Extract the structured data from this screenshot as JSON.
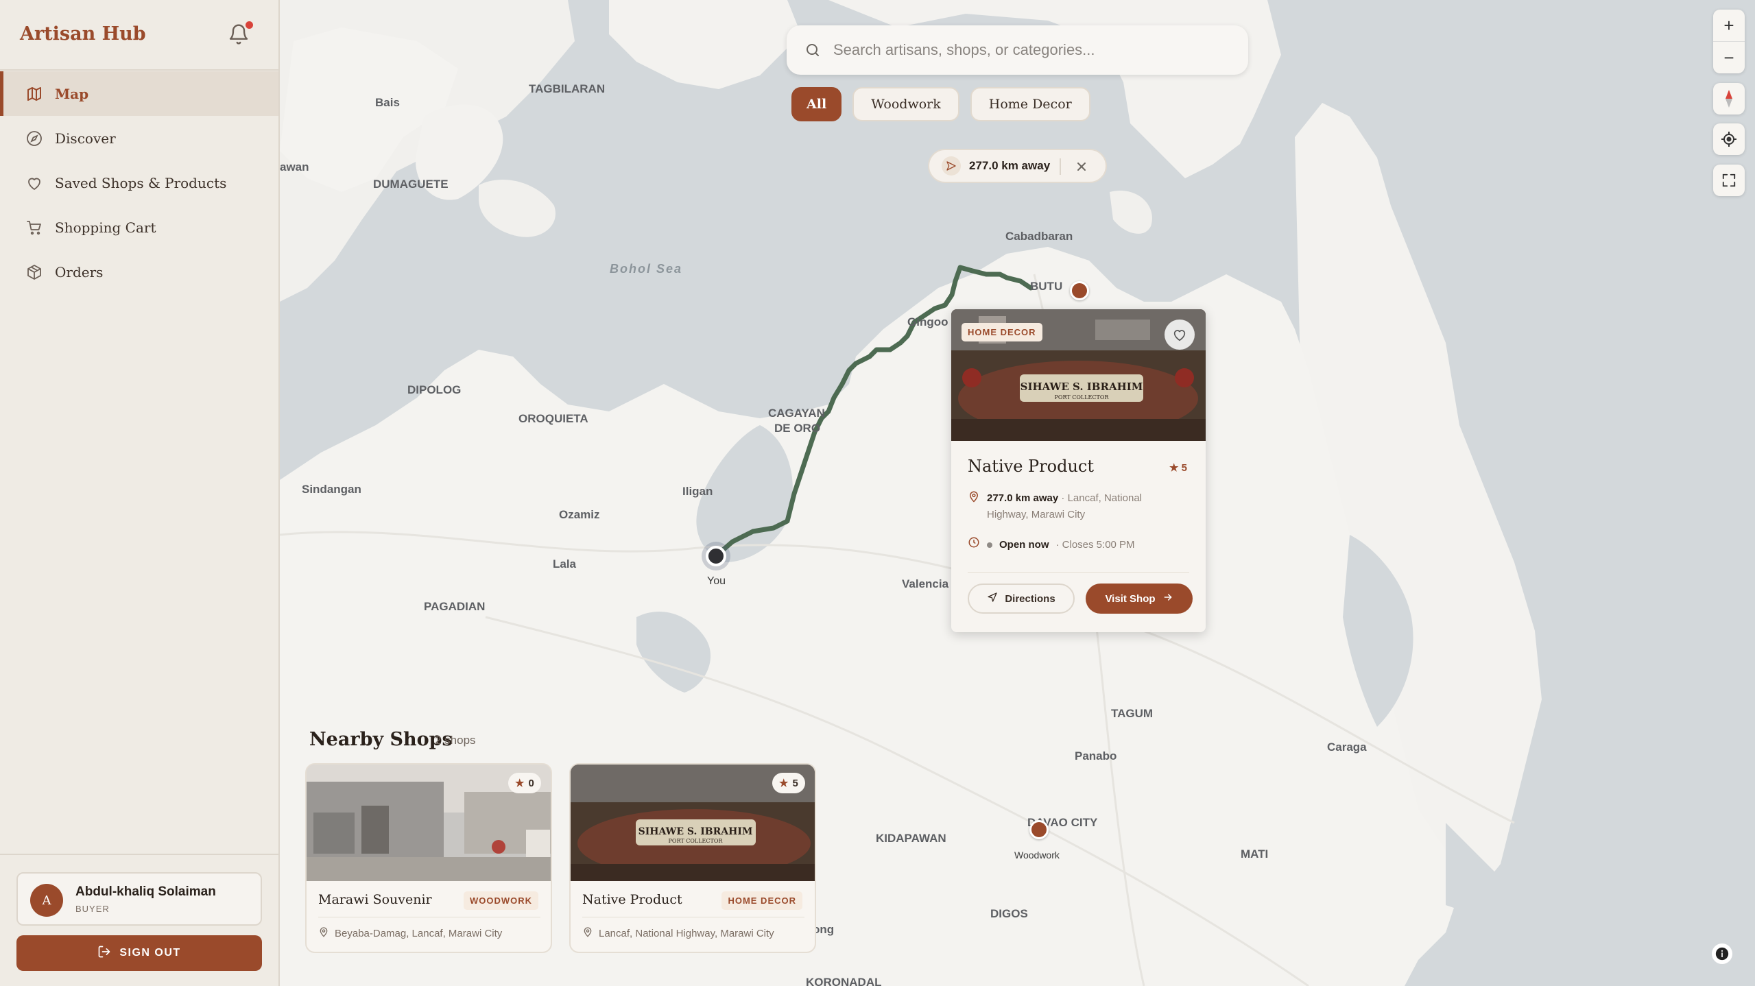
{
  "app": {
    "title": "Artisan Hub"
  },
  "sidebar": {
    "items": [
      {
        "label": "Map",
        "icon": "map-icon",
        "active": true
      },
      {
        "label": "Discover",
        "icon": "compass-icon"
      },
      {
        "label": "Saved Shops & Products",
        "icon": "heart-icon"
      },
      {
        "label": "Shopping Cart",
        "icon": "cart-icon"
      },
      {
        "label": "Orders",
        "icon": "box-icon"
      }
    ],
    "user": {
      "initial": "A",
      "name": "Abdul-khaliq Solaiman",
      "role": "BUYER"
    },
    "signout_label": "SIGN OUT"
  },
  "search": {
    "placeholder": "Search artisans, shops, or categories..."
  },
  "filters": [
    {
      "label": "All",
      "active": true
    },
    {
      "label": "Woodwork"
    },
    {
      "label": "Home Decor"
    }
  ],
  "distance_pill": {
    "text": "277.0 km away"
  },
  "map": {
    "sea_label": "Bohol Sea",
    "places": [
      "TAGBILARAN",
      "Bais",
      "awan",
      "DUMAGUETE",
      "Cabadbaran",
      "BUTU",
      "Gingoo",
      "DIPOLOG",
      "OROQUIETA",
      "CAGAYAN",
      "DE ORO",
      "Sindangan",
      "Iligan",
      "Ozamiz",
      "Lala",
      "PAGADIAN",
      "Valencia",
      "TAGUM",
      "Panabo",
      "Caraga",
      "DAVAO CITY",
      "KIDAPAWAN",
      "MATI",
      "DIGOS",
      "ong",
      "KORONADAL"
    ],
    "you_label": "You",
    "marker_label": "Woodwork",
    "route_color": "#4d6b52",
    "accent": "#9a4a2b"
  },
  "popup": {
    "tag": "HOME DECOR",
    "title": "Native Product",
    "rating": "5",
    "distance": "277.0 km away",
    "address": "· Lancaf, National Highway, Marawi City",
    "status": "Open now",
    "closes": "· Closes 5:00 PM",
    "directions_label": "Directions",
    "visit_label": "Visit Shop"
  },
  "nearby": {
    "title": "Nearby Shops",
    "count": "2 shops",
    "shops": [
      {
        "name": "Marawi Souvenir",
        "tag": "WOODWORK",
        "rating": "0",
        "address": "Beyaba-Damag, Lancaf, Marawi City"
      },
      {
        "name": "Native Product",
        "tag": "HOME DECOR",
        "rating": "5",
        "address": "Lancaf, National Highway, Marawi City"
      }
    ]
  },
  "controls": {
    "zoom_in": "+",
    "zoom_out": "−"
  }
}
